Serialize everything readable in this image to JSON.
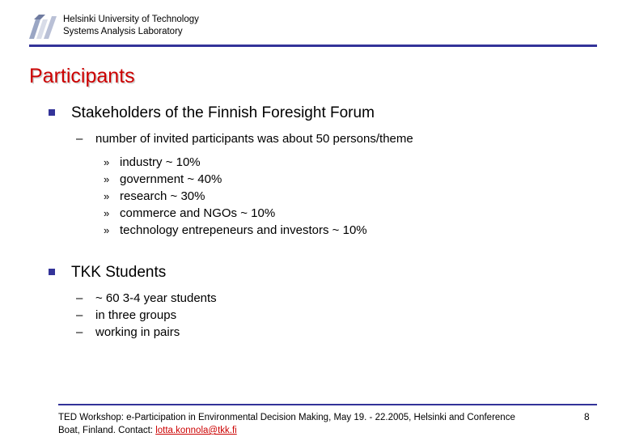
{
  "header": {
    "org_line1": "Helsinki University of Technology",
    "org_line2": "Systems Analysis Laboratory",
    "logo_name": "hut-sal-logo"
  },
  "title": "Participants",
  "content": {
    "sections": [
      {
        "heading": "Stakeholders of the Finnish Foresight Forum",
        "sub": "number of invited participants was about 50 persons/theme",
        "items": [
          "industry ~ 10%",
          "government ~ 40%",
          "research ~ 30%",
          "commerce and NGOs ~ 10%",
          "technology entrepeneurs and investors ~ 10%"
        ]
      },
      {
        "heading": "TKK Students",
        "subs": [
          "~ 60 3-4 year students",
          "in three groups",
          "working in pairs"
        ]
      }
    ],
    "bullet_lvl2": "–",
    "bullet_lvl3": "»"
  },
  "footer": {
    "line1": "TED Workshop: e-Participation in Environmental Decision Making, May 19. - 22.2005, Helsinki and Conference",
    "line2_prefix": "Boat, Finland. Contact: ",
    "line2_link": "lotta.konnola@tkk.fi",
    "slide_number": "8"
  },
  "colors": {
    "accent_rule": "#333399",
    "title": "#cc0000",
    "link": "#cc0000"
  }
}
